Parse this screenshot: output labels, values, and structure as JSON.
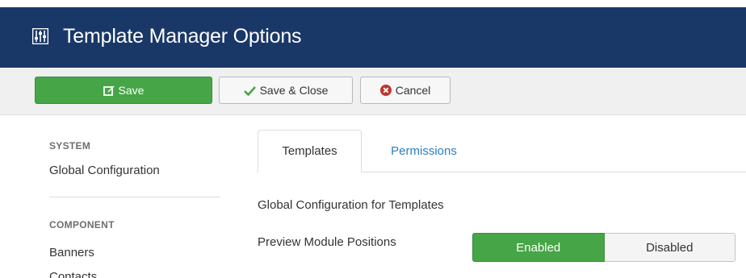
{
  "header": {
    "title": "Template Manager Options",
    "icon": "equalizer-icon"
  },
  "toolbar": {
    "save_label": "Save",
    "save_close_label": "Save & Close",
    "cancel_label": "Cancel"
  },
  "sidebar": {
    "sections": [
      {
        "heading": "SYSTEM",
        "items": [
          "Global Configuration"
        ]
      },
      {
        "heading": "COMPONENT",
        "items": [
          "Banners",
          "Contacts"
        ]
      }
    ]
  },
  "tabs": [
    {
      "label": "Templates",
      "active": true
    },
    {
      "label": "Permissions",
      "active": false
    }
  ],
  "content": {
    "section_title": "Global Configuration for Templates",
    "field_label": "Preview Module Positions",
    "toggle": {
      "on_label": "Enabled",
      "off_label": "Disabled",
      "selected": "Enabled"
    }
  },
  "colors": {
    "header_bg": "#1a3867",
    "success": "#46a546",
    "link": "#2a80c2",
    "danger": "#bd362f"
  }
}
